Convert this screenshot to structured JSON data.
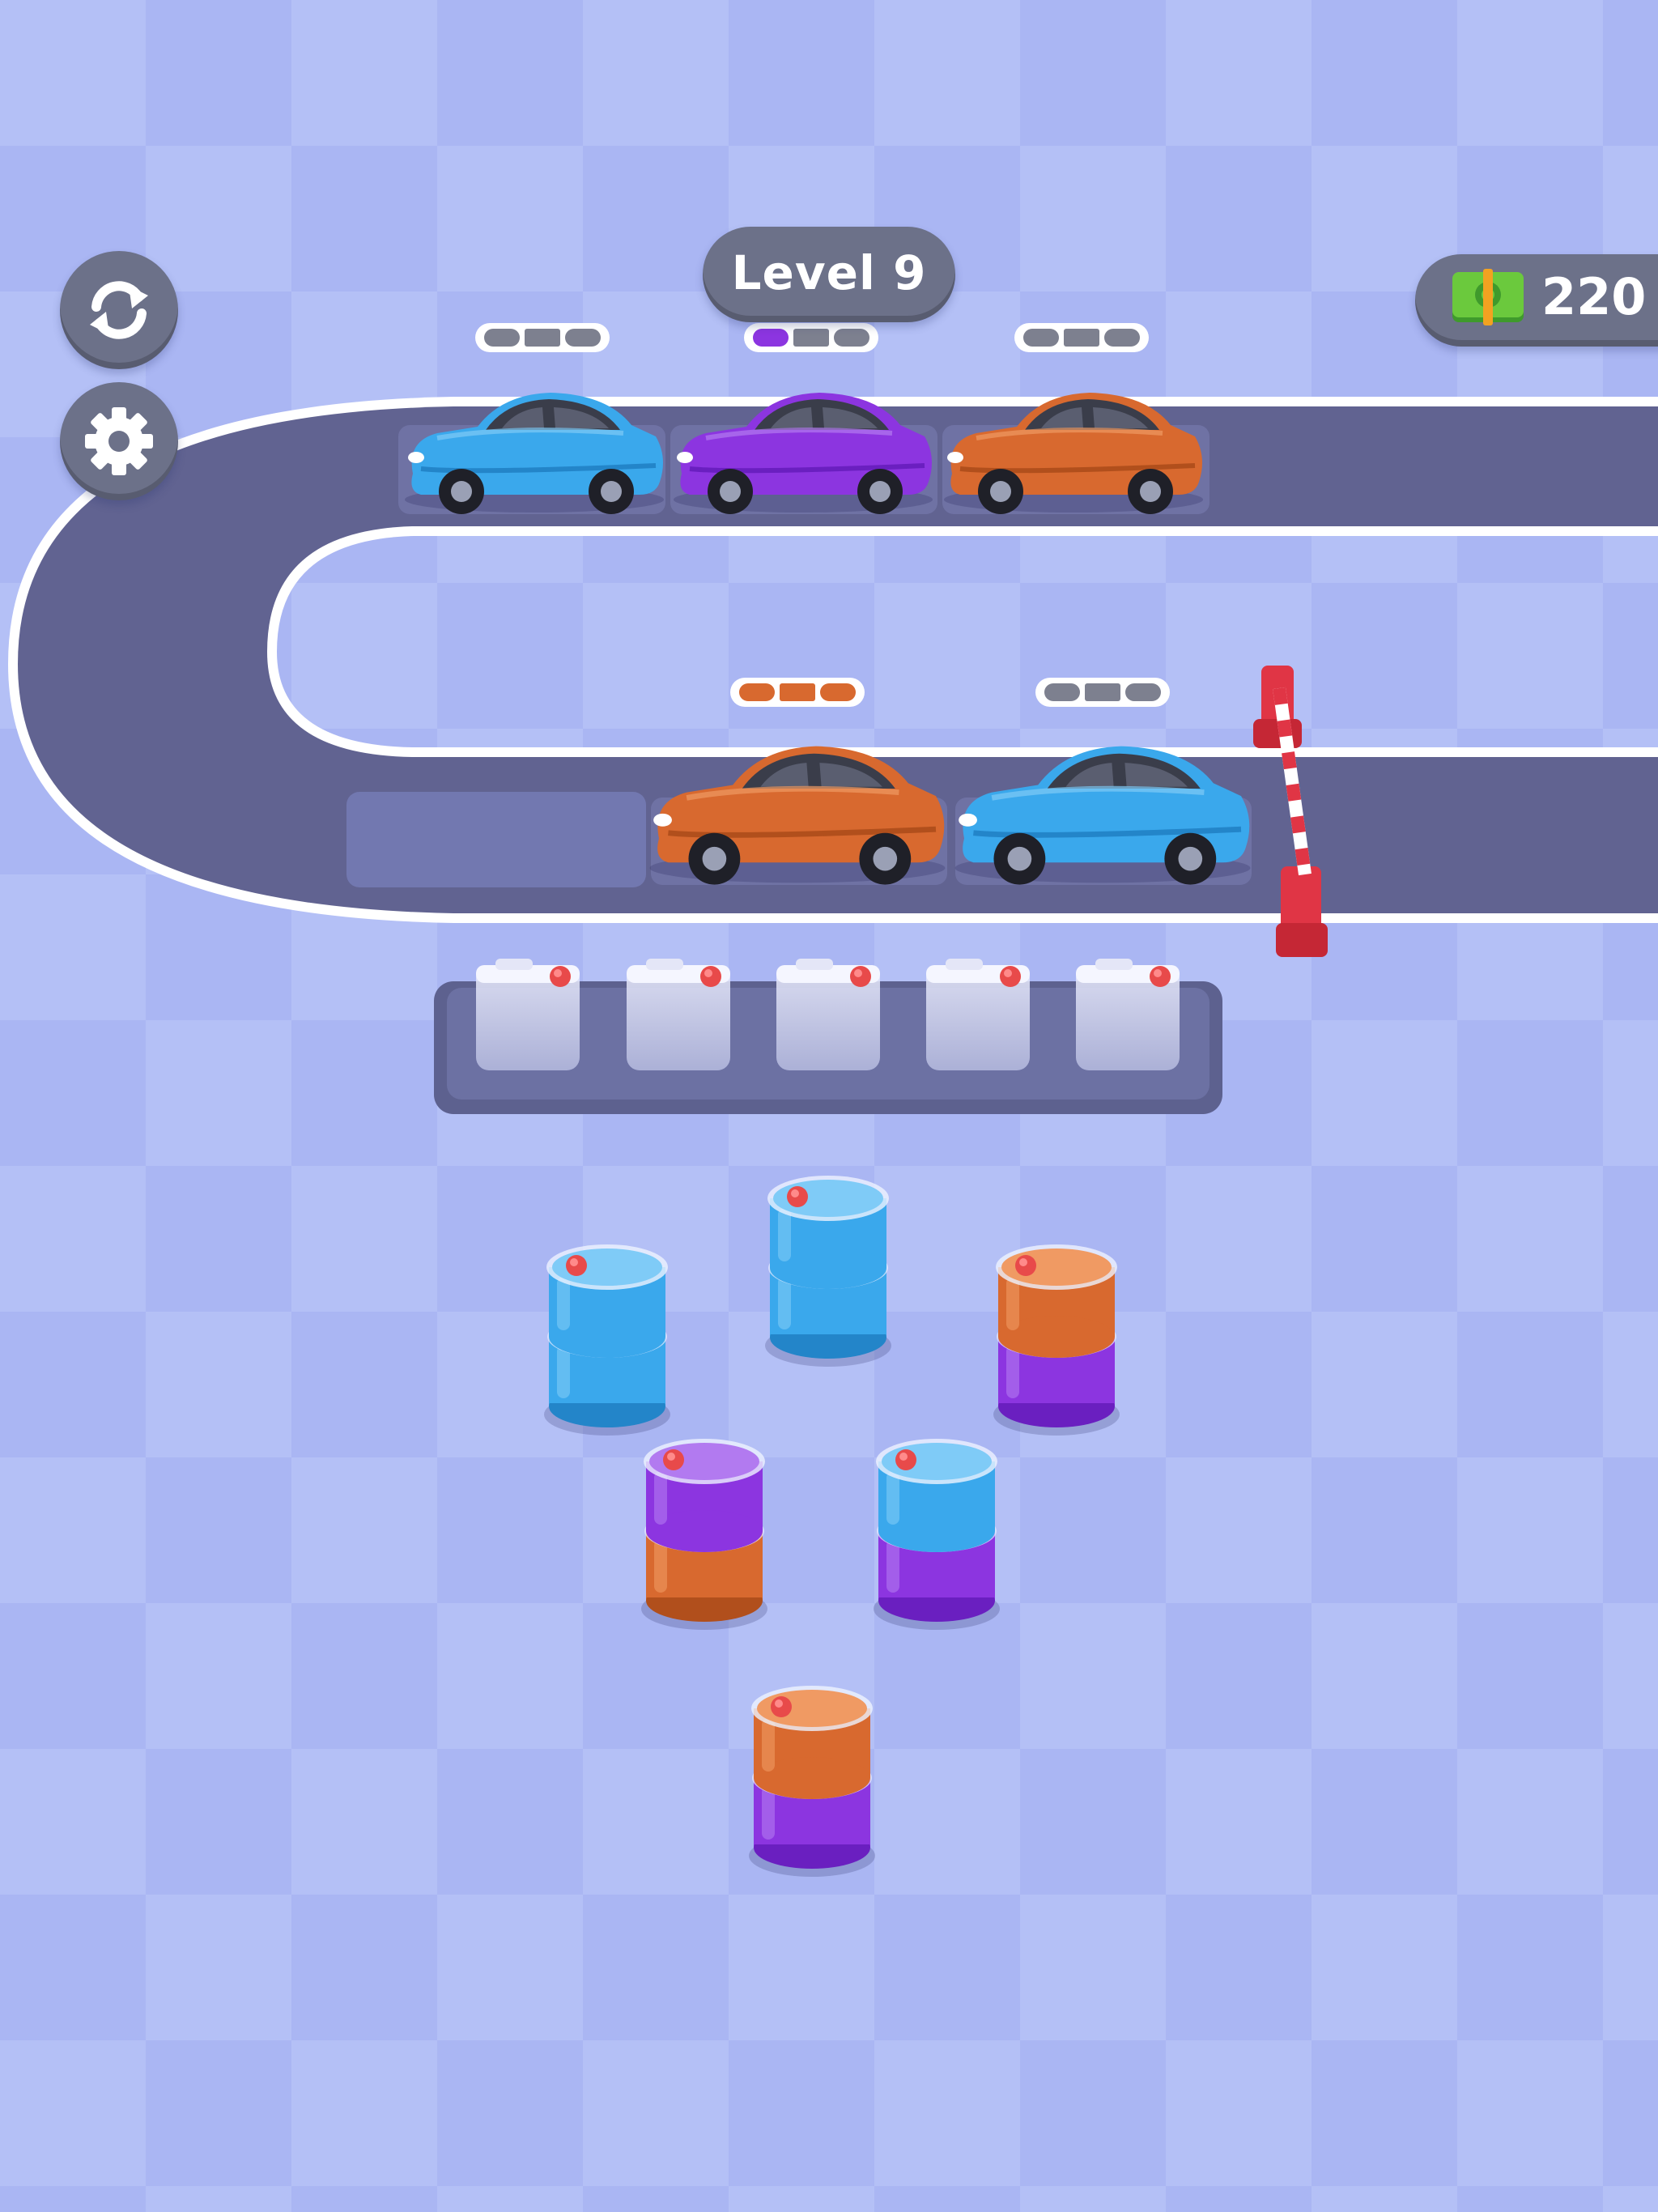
{
  "hud": {
    "level_label": "Level 9",
    "money": "220",
    "restart_icon": "restart-icon",
    "settings_icon": "gear-icon",
    "money_icon": "cash-stack-icon"
  },
  "colors": {
    "blue": "#3aa8ec",
    "purple": "#8c35e0",
    "orange": "#d8692f",
    "road": "#616391",
    "background": "#aab6f3"
  },
  "track": {
    "top_row_cars": [
      {
        "color": "blue",
        "fuel_filled": 0,
        "fuel_total": 3
      },
      {
        "color": "purple",
        "fuel_filled": 1,
        "fuel_total": 3
      },
      {
        "color": "orange",
        "fuel_filled": 0,
        "fuel_total": 3
      }
    ],
    "bottom_row_cars": [
      {
        "color": "empty-slot"
      },
      {
        "color": "orange",
        "fuel_filled": 3,
        "fuel_total": 3
      },
      {
        "color": "blue",
        "fuel_filled": 0,
        "fuel_total": 3
      }
    ],
    "gate": "red-white-barrier"
  },
  "jerrycan_tray": {
    "slots": 5,
    "filled": 0
  },
  "barrels": [
    {
      "layers": [
        "blue",
        "blue"
      ]
    },
    {
      "layers": [
        "blue",
        "blue"
      ]
    },
    {
      "layers": [
        "purple",
        "orange"
      ]
    },
    {
      "layers": [
        "orange",
        "purple"
      ]
    },
    {
      "layers": [
        "blue",
        "purple"
      ]
    },
    {
      "layers": [
        "orange",
        "purple"
      ]
    }
  ]
}
